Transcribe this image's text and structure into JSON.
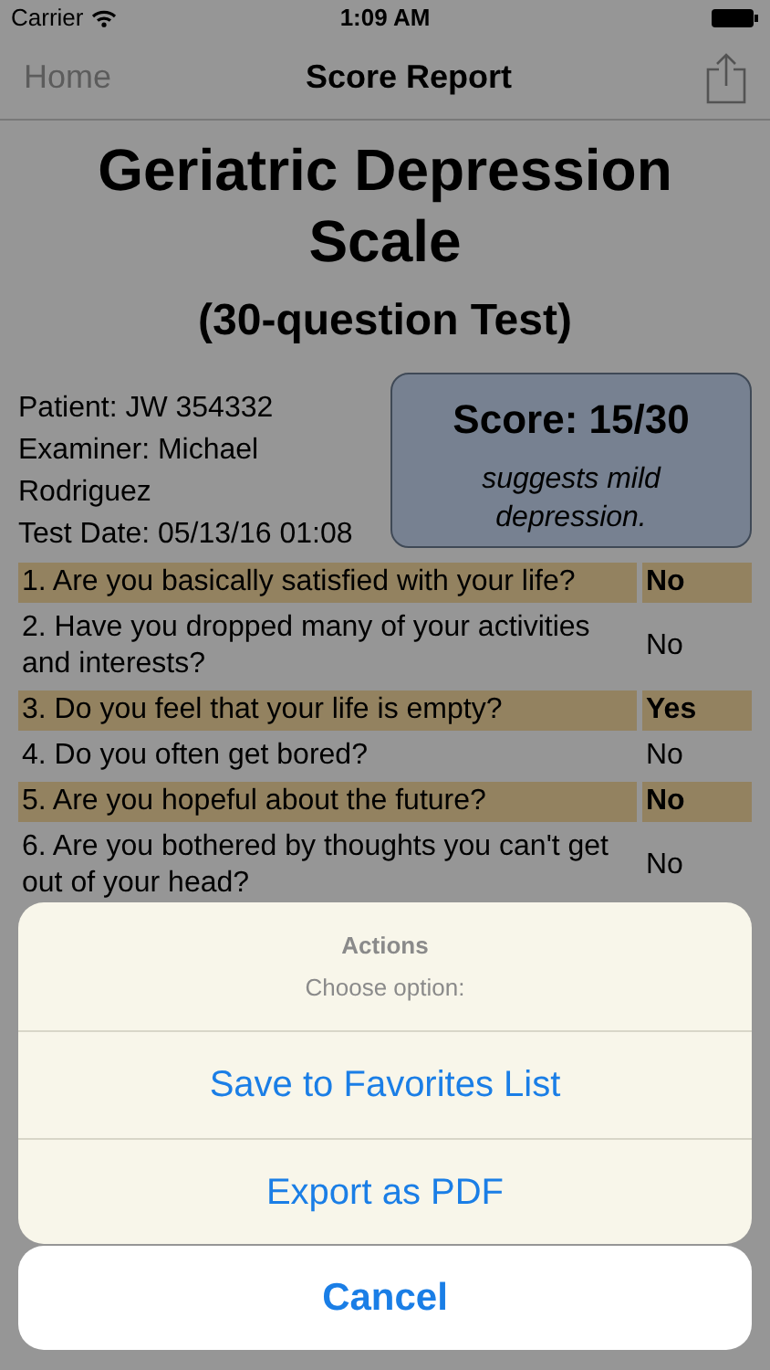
{
  "status_bar": {
    "carrier": "Carrier",
    "time": "1:09 AM"
  },
  "nav": {
    "back": "Home",
    "title": "Score Report"
  },
  "report": {
    "title": "Geriatric Depression Scale",
    "subtitle": "(30-question Test)",
    "info": [
      "Patient: JW 354332",
      "Examiner: Michael Rodriguez",
      "Test Date: 05/13/16 01:08"
    ],
    "score": "Score: 15/30",
    "interpretation": "suggests mild depression."
  },
  "questions": [
    {
      "text": "1. Are you basically satisfied with your life?",
      "answer": "No",
      "highlighted": true
    },
    {
      "text": "2. Have you dropped many of your activities and interests?",
      "answer": "No",
      "highlighted": false
    },
    {
      "text": "3. Do you feel that your life is empty?",
      "answer": "Yes",
      "highlighted": true
    },
    {
      "text": "4. Do you often get bored?",
      "answer": "No",
      "highlighted": false
    },
    {
      "text": "5. Are you hopeful about the future?",
      "answer": "No",
      "highlighted": true
    },
    {
      "text": "6. Are you bothered by thoughts you can't get out of your head?",
      "answer": "No",
      "highlighted": false
    }
  ],
  "action_sheet": {
    "title": "Actions",
    "message": "Choose option:",
    "options": [
      "Save to Favorites List",
      "Export as PDF"
    ],
    "cancel": "Cancel"
  }
}
